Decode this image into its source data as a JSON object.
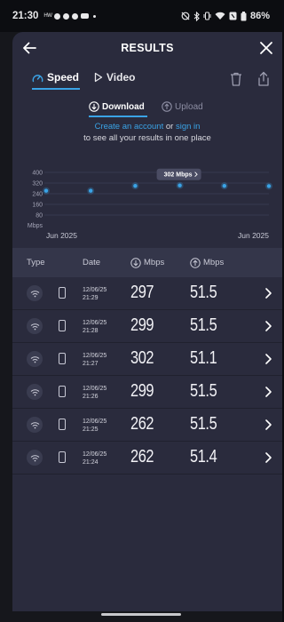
{
  "status_bar": {
    "time": "21:30",
    "carrier_small": "HW",
    "battery": "86%"
  },
  "header": {
    "title": "RESULTS"
  },
  "tabs": {
    "speed": "Speed",
    "video": "Video"
  },
  "direction": {
    "download": "Download",
    "upload": "Upload"
  },
  "signin": {
    "link1": "Create an account",
    "or": " or ",
    "link2": "sign in",
    "line2": "to see all your results in one place"
  },
  "chart_data": {
    "type": "scatter",
    "y_ticks": [
      "400",
      "320",
      "240",
      "160",
      "80"
    ],
    "ylabel": "Mbps",
    "ylim": [
      0,
      400
    ],
    "x_labels": [
      "Jun 2025",
      "Jun 2025"
    ],
    "values": [
      262,
      262,
      299,
      302,
      299,
      297
    ],
    "tooltip": "302 Mbps",
    "tooltip_index": 3,
    "accent": "#3aa3e6"
  },
  "table": {
    "headers": {
      "type": "Type",
      "date": "Date",
      "down": "Mbps",
      "up": "Mbps"
    },
    "rows": [
      {
        "date": "12/06/25",
        "time": "21:29",
        "down": "297",
        "up": "51.5"
      },
      {
        "date": "12/06/25",
        "time": "21:28",
        "down": "299",
        "up": "51.5"
      },
      {
        "date": "12/06/25",
        "time": "21:27",
        "down": "302",
        "up": "51.1"
      },
      {
        "date": "12/06/25",
        "time": "21:26",
        "down": "299",
        "up": "51.5"
      },
      {
        "date": "12/06/25",
        "time": "21:25",
        "down": "262",
        "up": "51.5"
      },
      {
        "date": "12/06/25",
        "time": "21:24",
        "down": "262",
        "up": "51.4"
      }
    ]
  }
}
